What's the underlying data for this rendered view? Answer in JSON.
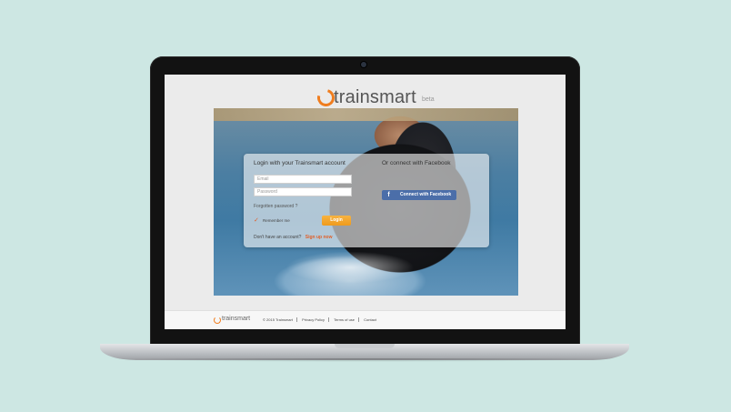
{
  "app": {
    "brand": "trainsmart",
    "brand_tag": "beta"
  },
  "login": {
    "title": "Login with your Trainsmart account",
    "email_placeholder": "Email",
    "password_placeholder": "Password",
    "forgot_label": "Forgotten password ?",
    "remember_label": "Remember me",
    "login_button": "Login",
    "signup_prompt": "Don't have an account?",
    "signup_link": "Sign up now"
  },
  "facebook": {
    "title": "Or connect with Facebook",
    "button_label": "Connect with Facebook",
    "icon": "facebook-icon"
  },
  "footer": {
    "brand": "trainsmart",
    "links": [
      "© 2015 Trainsmart",
      "Privacy Policy",
      "Terms of use",
      "Contact"
    ]
  },
  "colors": {
    "accent": "#f07d1e",
    "login_button": "#ef9a1c",
    "facebook": "#4b6ea9",
    "background": "#cde7e3"
  }
}
